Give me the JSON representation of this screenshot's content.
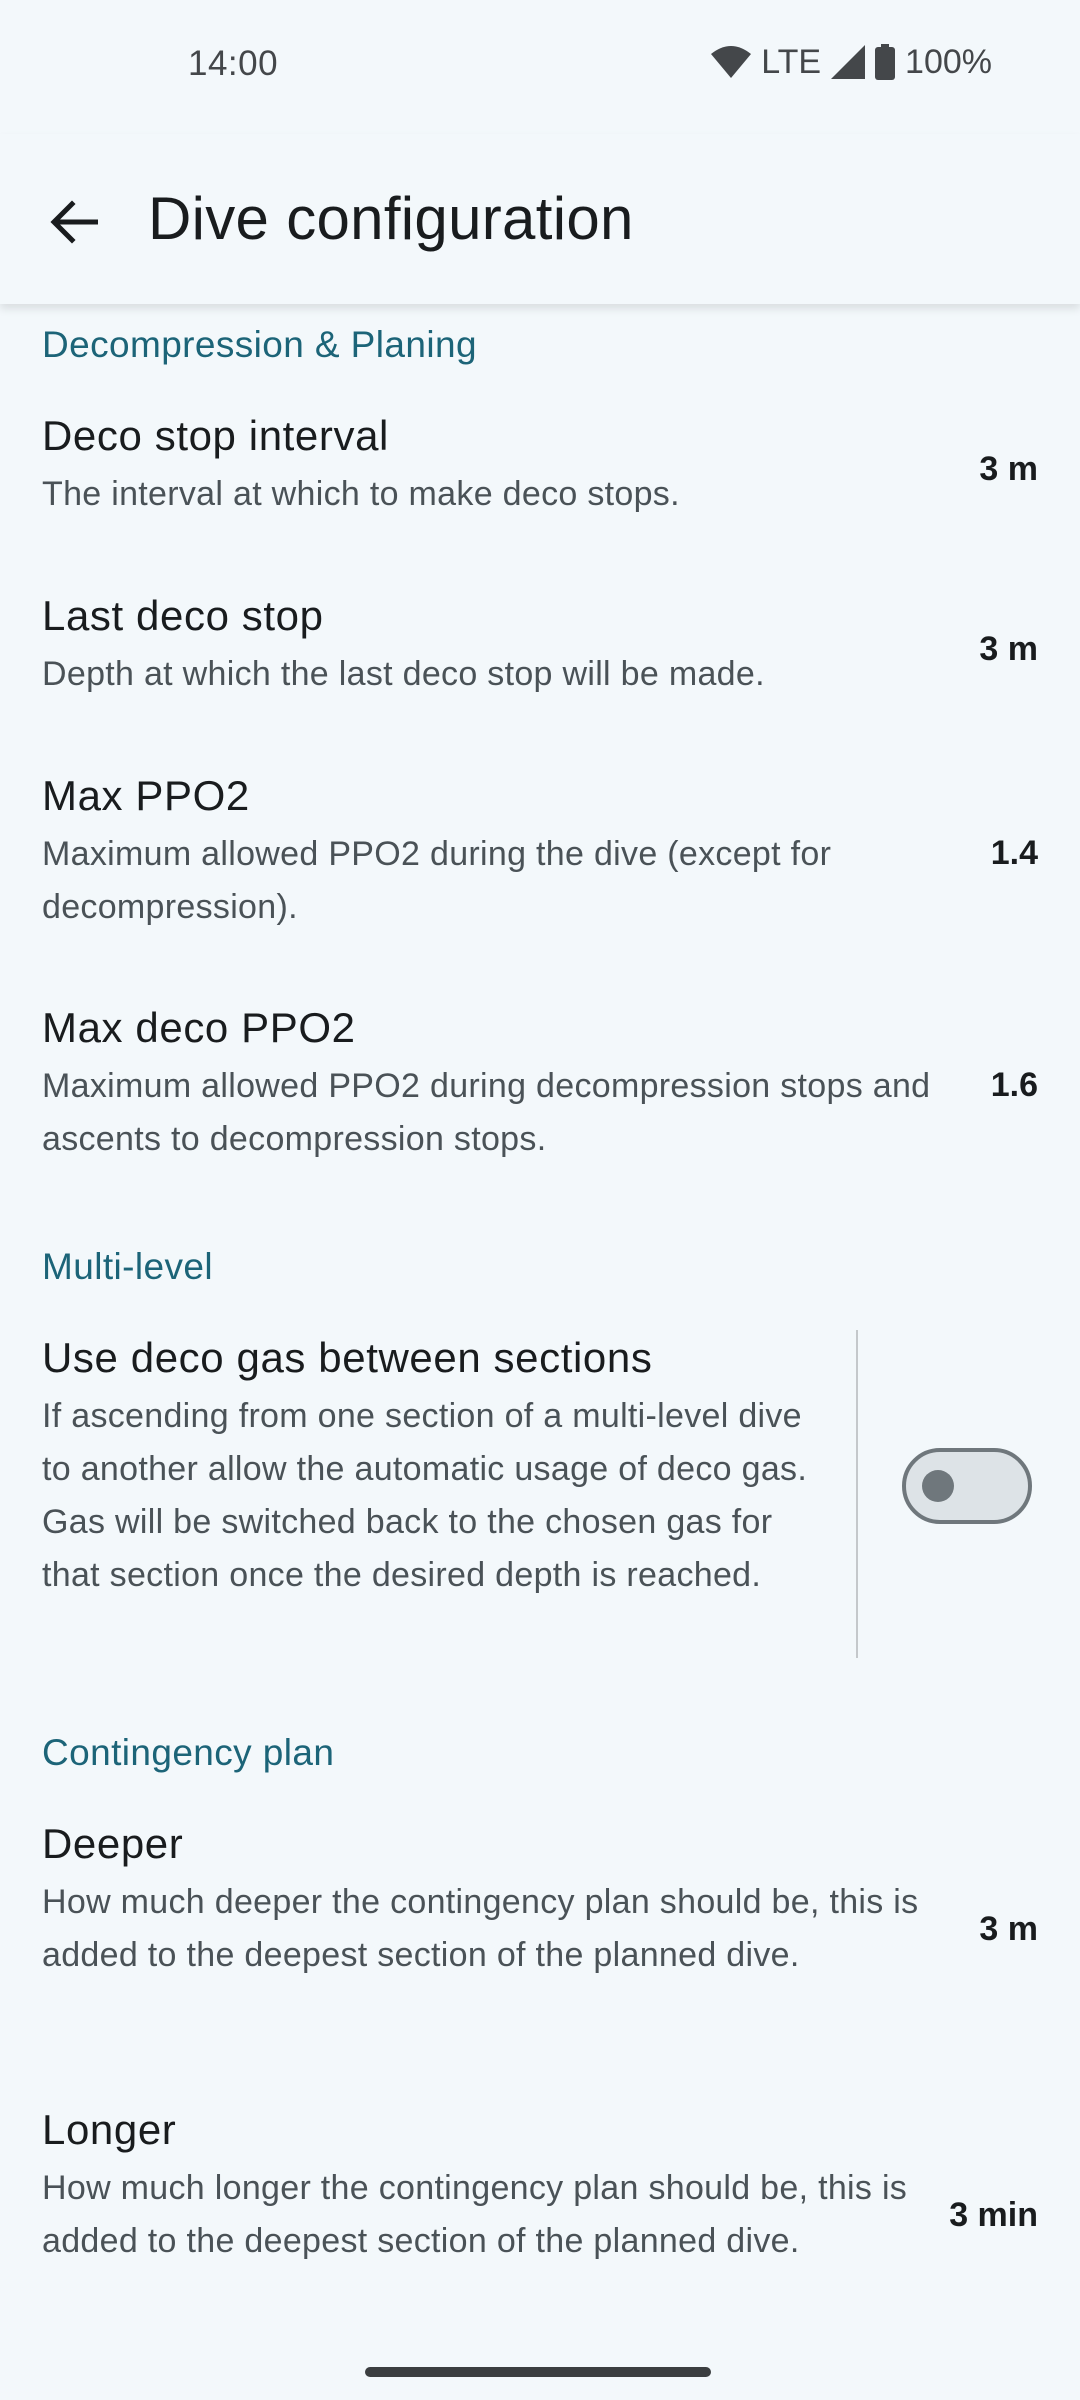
{
  "status_bar": {
    "time": "14:00",
    "network": "LTE",
    "battery": "100%",
    "icons": [
      "wifi-icon",
      "signal-icon",
      "battery-icon"
    ]
  },
  "app_bar": {
    "title": "Dive configuration",
    "back_icon": "arrow-back-icon"
  },
  "sections": {
    "deco": {
      "title": "Decompression & Planing",
      "deco_stop_interval": {
        "title": "Deco stop interval",
        "summary": "The interval at which to make deco stops.",
        "value": "3 m"
      },
      "last_deco_stop": {
        "title": "Last deco stop",
        "summary": "Depth at which the last deco stop will be made.",
        "value": "3 m"
      },
      "max_ppo2": {
        "title": "Max PPO2",
        "summary": "Maximum allowed PPO2 during the dive (except for decompression).",
        "value": "1.4"
      },
      "max_deco_ppo2": {
        "title": "Max deco PPO2",
        "summary": "Maximum allowed PPO2 during decompression stops and ascents to decompression stops.",
        "value": "1.6"
      }
    },
    "multilevel": {
      "title": "Multi-level",
      "deco_gas": {
        "title": "Use deco gas between sections",
        "summary": "If ascending from one section of a multi-level dive to another allow the automatic usage of deco gas. Gas will be switched back to the chosen gas for that section once the desired depth is reached.",
        "enabled": false
      }
    },
    "contingency": {
      "title": "Contingency plan",
      "deeper": {
        "title": "Deeper",
        "summary": "How much deeper the contingency plan should be, this is added to the deepest section of the planned dive.",
        "value": "3 m"
      },
      "longer": {
        "title": "Longer",
        "summary": "How much longer the contingency plan should be, this is added to the deepest section of the planned dive.",
        "value": "3 min"
      }
    }
  },
  "colors": {
    "background": "#f3f8fb",
    "accent": "#1c6478",
    "text_primary": "#191c1e",
    "text_secondary": "#4a5257"
  }
}
